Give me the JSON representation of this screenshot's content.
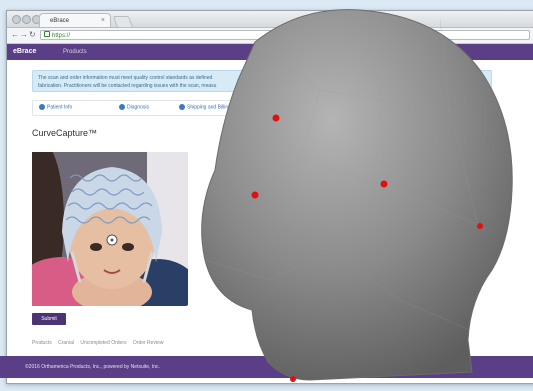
{
  "browser": {
    "tab_title": "eBrace",
    "url": "https://"
  },
  "app": {
    "brand": "eBrace",
    "nav_products": "Products"
  },
  "notice": {
    "line1": "The scan and order information must meet quality control standards as defined",
    "line2": "fabrication. Practitioners will be contacted regarding issues with the scan, measu"
  },
  "steps": [
    "Patient Info",
    "Diagnosis",
    "Shipping and Billing"
  ],
  "page_title": "CurveCapture™",
  "submit_label": "Submit",
  "breadcrumbs": [
    "Products",
    "Cranial",
    "Uncompleted Orders",
    "Order Review"
  ],
  "footer": "©2016 Orthamerica Products, Inc., powered by Netsuite, Inc.",
  "colors": {
    "brand_purple": "#5b3f86",
    "notice_blue": "#d7ebf7",
    "head_gray": "#8e8e8e",
    "marker_red": "#e01010"
  },
  "icons": [
    "back-icon",
    "forward-icon",
    "reload-icon",
    "lock-icon",
    "user-icon",
    "diagnosis-icon",
    "shipping-icon",
    "close-tab-icon"
  ]
}
